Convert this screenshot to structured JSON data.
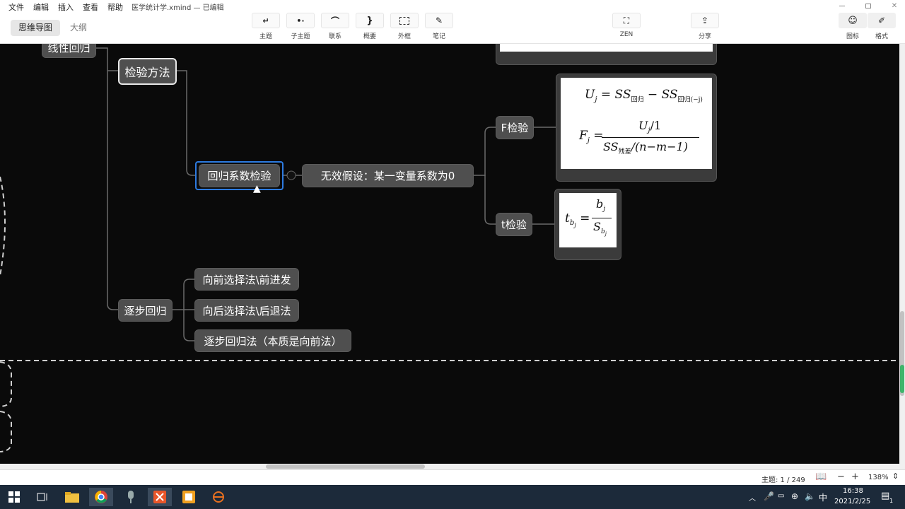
{
  "menu": {
    "file": "文件",
    "edit": "编辑",
    "insert": "插入",
    "view": "查看",
    "help": "帮助"
  },
  "window_title": "医学统计学.xmind — 已编辑",
  "view_tabs": {
    "mindmap": "思维导图",
    "outline": "大纲"
  },
  "toolbar": {
    "topic": "主题",
    "subtopic": "子主题",
    "relationship": "联系",
    "summary": "概要",
    "boundary": "外框",
    "note": "笔记",
    "zen": "ZEN",
    "share": "分享",
    "icon": "图标",
    "format": "格式"
  },
  "nodes": {
    "linear_regression": "线性回归",
    "test_methods": "检验方法",
    "coef_test": "回归系数检验",
    "null_hypothesis": "无效假设：某一变量系数为0",
    "f_test": "F检验",
    "t_test": "t检验",
    "stepwise": "逐步回归",
    "forward": "向前选择法\\前进发",
    "backward": "向后选择法\\后退法",
    "stepwise_method": "逐步回归法（本质是向前法）"
  },
  "formulas": {
    "u_lhs": "U",
    "u_sub": "j",
    "ss": "SS",
    "sub_reg": "回归",
    "sub_reg_minus": "回归(−j)",
    "f_lhs": "F",
    "f_num": "U",
    "f_num_tail": "/1",
    "f_den_sub": "残差",
    "f_den_tail": "/(n−m−1)",
    "t_lhs": "t",
    "t_sub": "b",
    "t_subsub": "j",
    "t_num": "b",
    "t_den": "S"
  },
  "status": {
    "topic_count": "主题: 1 / 249",
    "zoom": "138%"
  },
  "taskbar": {
    "time": "16:38",
    "date": "2021/2/25",
    "ime": "中",
    "notifications": "1"
  },
  "colors": {
    "canvas": "#0a0a0a",
    "node": "#4f4f4f",
    "selected": "#2d7be0",
    "taskbar": "#1c2a3a"
  }
}
